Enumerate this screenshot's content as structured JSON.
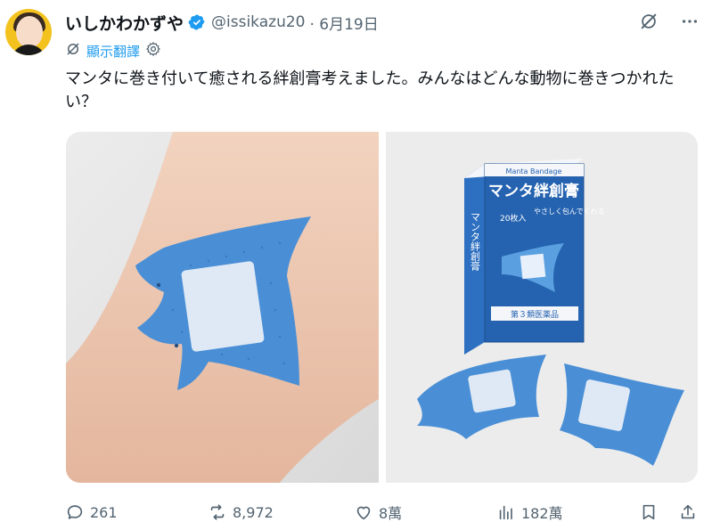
{
  "user": {
    "display_name": "いしかわかずや",
    "handle": "@issikazu20",
    "date": "· 6月19日"
  },
  "translate_label": "顯示翻譯",
  "tweet_text": "マンタに巻き付いて癒される絆創膏考えました。みんなはどんな動物に巻きつかれたい？",
  "photo2": {
    "box_subtitle": "Manta Bandage",
    "box_title": "マンタ絆創膏",
    "box_count": "20枚入",
    "box_tagline": "やさしく包んでくれる",
    "box_side": "マンタ絆創膏",
    "box_category": "第３類医薬品"
  },
  "actions": {
    "replies": "261",
    "reposts": "8,972",
    "likes": "8萬",
    "views": "182萬"
  },
  "colors": {
    "accent": "#1d9bf0",
    "muted": "#536471",
    "bandage": "#4a8fd6"
  },
  "icons": [
    "verified-badge-icon",
    "grok-icon",
    "more-icon",
    "translate-icon",
    "settings-icon",
    "reply-icon",
    "repost-icon",
    "like-icon",
    "views-icon",
    "bookmark-icon",
    "share-icon"
  ]
}
